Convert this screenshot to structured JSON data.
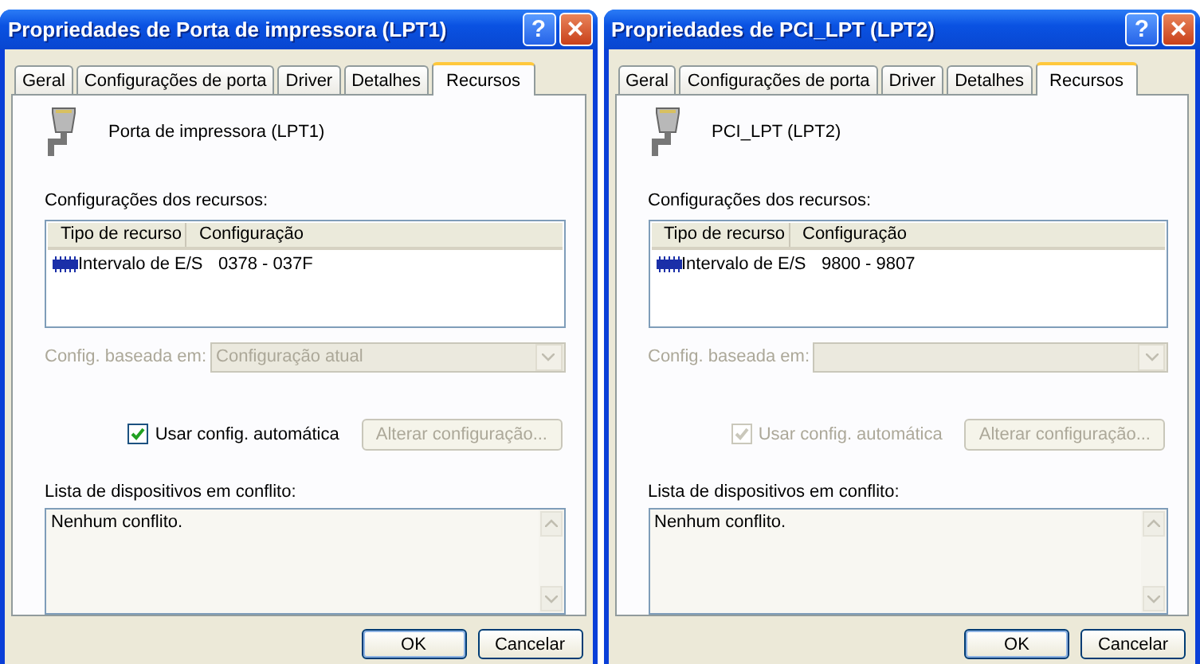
{
  "windows": [
    {
      "title": "Propriedades de Porta de impressora (LPT1)",
      "help": "?",
      "close": "×",
      "tabs": [
        {
          "label": "Geral",
          "selected": false
        },
        {
          "label": "Configurações de porta",
          "selected": false
        },
        {
          "label": "Driver",
          "selected": false
        },
        {
          "label": "Detalhes",
          "selected": false
        },
        {
          "label": "Recursos",
          "selected": true
        }
      ],
      "device_name": "Porta de impressora (LPT1)",
      "resources_label": "Configurações dos recursos:",
      "columns": [
        "Tipo de recurso",
        "Configuração"
      ],
      "rows": [
        {
          "type": "Intervalo de E/S",
          "setting": "0378 - 037F"
        }
      ],
      "based_on": {
        "label": "Config. baseada em:",
        "value": "Configuração atual",
        "disabled": true
      },
      "auto_config": {
        "label": "Usar config. automática",
        "checked": true,
        "disabled": false
      },
      "change_button": {
        "label": "Alterar configuração...",
        "disabled": true
      },
      "conflict_label": "Lista de dispositivos em conflito:",
      "conflict_text": "Nenhum conflito.",
      "buttons": [
        "OK",
        "Cancelar"
      ]
    },
    {
      "title": "Propriedades de PCI_LPT (LPT2)",
      "help": "?",
      "close": "×",
      "tabs": [
        {
          "label": "Geral",
          "selected": false
        },
        {
          "label": "Configurações de porta",
          "selected": false
        },
        {
          "label": "Driver",
          "selected": false
        },
        {
          "label": "Detalhes",
          "selected": false
        },
        {
          "label": "Recursos",
          "selected": true
        }
      ],
      "device_name": "PCI_LPT (LPT2)",
      "resources_label": "Configurações dos recursos:",
      "columns": [
        "Tipo de recurso",
        "Configuração"
      ],
      "rows": [
        {
          "type": "Intervalo de E/S",
          "setting": "9800 - 9807"
        }
      ],
      "based_on": {
        "label": "Config. baseada em:",
        "disabled": true
      },
      "auto_config": {
        "label": "Usar config. automática",
        "checked": true,
        "disabled": true
      },
      "change_button": {
        "label": "Alterar configuração...",
        "disabled": true
      },
      "conflict_label": "Lista de dispositivos em conflito:",
      "conflict_text": "Nenhum conflito.",
      "buttons": [
        "OK",
        "Cancelar"
      ]
    }
  ]
}
